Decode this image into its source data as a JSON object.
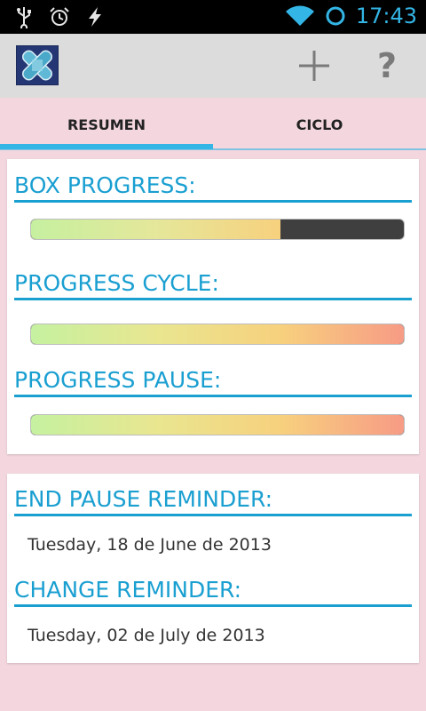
{
  "status_bar": {
    "time": "17:43",
    "icons": [
      "usb-icon",
      "alarm-icon",
      "charging-icon",
      "wifi-icon",
      "sync-icon"
    ]
  },
  "action_bar": {
    "logo": "app-logo",
    "add_icon": "plus-icon",
    "help_label": "?"
  },
  "tabs": [
    {
      "label": "RESUMEN",
      "selected": true
    },
    {
      "label": "CICLO",
      "selected": false
    }
  ],
  "progress_card": {
    "box_progress": {
      "title": "BOX PROGRESS:",
      "value": 0.67
    },
    "progress_cycle": {
      "title": "PROGRESS CYCLE:",
      "value": 1.0
    },
    "progress_pause": {
      "title": "PROGRESS PAUSE:",
      "value": 1.0
    }
  },
  "reminder_card": {
    "end_pause": {
      "title": "END PAUSE REMINDER:",
      "date": "Tuesday, 18 de June de 2013"
    },
    "change": {
      "title": "CHANGE REMINDER:",
      "date": "Tuesday, 02 de July de 2013"
    }
  },
  "colors": {
    "accent": "#33b5e5",
    "title_blue": "#1a9fd1",
    "background": "#f3d6de"
  }
}
